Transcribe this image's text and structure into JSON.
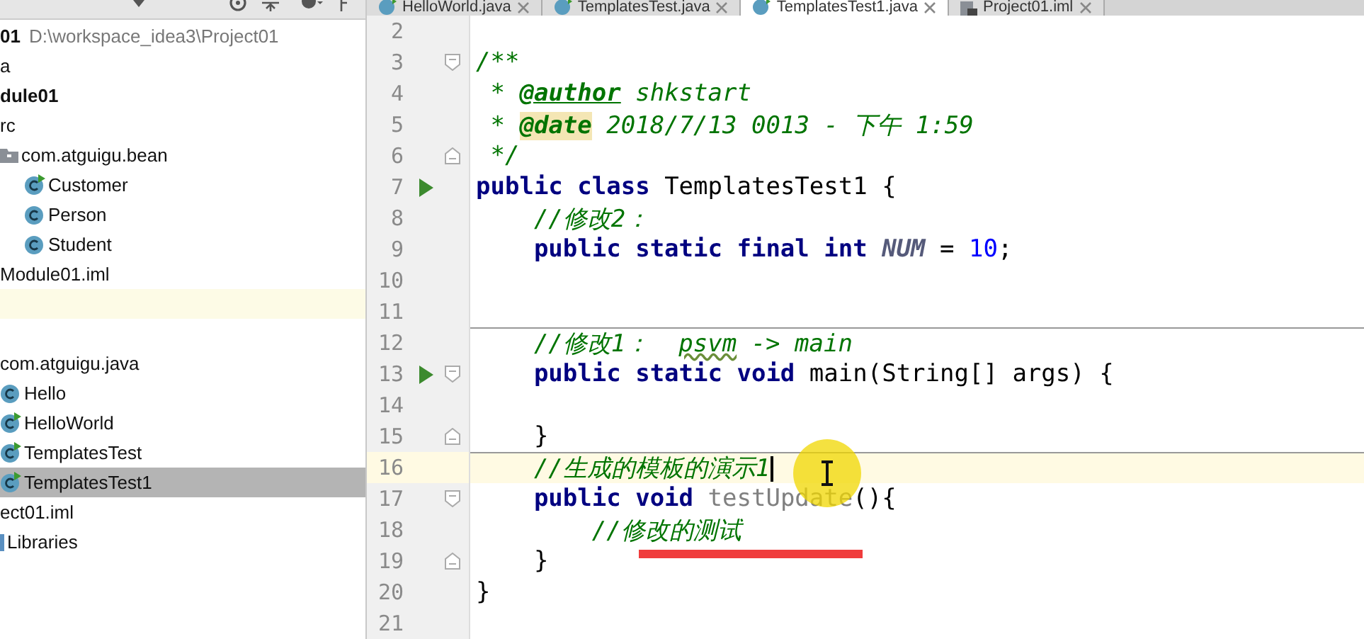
{
  "sidebar": {
    "tree": [
      {
        "label": "01",
        "path": "D:\\workspace_idea3\\Project01",
        "bold": true,
        "selected": false,
        "children": [
          {
            "label": "a",
            "selected": false
          },
          {
            "label": "dule01",
            "bold": true,
            "selected": false,
            "children": [
              {
                "label": "rc",
                "selected": false,
                "children": [
                  {
                    "label": "com.atguigu.bean",
                    "kind": "package",
                    "selected": false,
                    "children": [
                      {
                        "label": "Customer",
                        "kind": "class",
                        "runnable": true,
                        "selected": false
                      },
                      {
                        "label": "Person",
                        "kind": "class",
                        "runnable": false,
                        "selected": false
                      },
                      {
                        "label": "Student",
                        "kind": "class",
                        "runnable": false,
                        "selected": false
                      }
                    ]
                  }
                ]
              },
              {
                "label": "Module01.iml",
                "selected": false
              }
            ]
          },
          {
            "label": "com.atguigu.java",
            "selected": false,
            "children": [
              {
                "label": "Hello",
                "kind": "class",
                "runnable": false,
                "selected": false
              },
              {
                "label": "HelloWorld",
                "kind": "class",
                "runnable": true,
                "selected": false
              },
              {
                "label": "TemplatesTest",
                "kind": "class",
                "runnable": true,
                "selected": false
              },
              {
                "label": "TemplatesTest1",
                "kind": "class",
                "runnable": true,
                "selected": true
              }
            ]
          },
          {
            "label": "ect01.iml",
            "selected": false
          }
        ]
      },
      {
        "label": "Libraries",
        "kind": "library",
        "selected": false
      }
    ]
  },
  "tabs": [
    {
      "label": "HelloWorld.java",
      "kind": "class",
      "selected": false
    },
    {
      "label": "TemplatesTest.java",
      "kind": "class",
      "selected": false
    },
    {
      "label": "TemplatesTest1.java",
      "kind": "class",
      "selected": true
    },
    {
      "label": "Project01.iml",
      "kind": "module",
      "selected": false
    }
  ],
  "editor": {
    "lines": [
      {
        "number": "2"
      },
      {
        "number": "3",
        "fold_start": true,
        "tokens": [
          {
            "kind": "comment",
            "text": "/**"
          }
        ]
      },
      {
        "number": "4",
        "tokens": [
          {
            "kind": "comment",
            "text": " * "
          },
          {
            "kind": "doctag",
            "text": "@author"
          },
          {
            "kind": "comment",
            "text": " shkstart"
          }
        ]
      },
      {
        "number": "5",
        "tokens": [
          {
            "kind": "comment",
            "text": " * "
          },
          {
            "kind": "doctag-hl",
            "text": "@date"
          },
          {
            "kind": "comment",
            "text": " 2018/7/13 0013 - 下午 1:59"
          }
        ]
      },
      {
        "number": "6",
        "fold_end": true,
        "tokens": [
          {
            "kind": "comment",
            "text": " */"
          }
        ]
      },
      {
        "number": "7",
        "run": true,
        "tokens": [
          {
            "kind": "keyword",
            "text": "public class"
          },
          {
            "kind": "plain",
            "text": " TemplatesTest1 {"
          }
        ]
      },
      {
        "number": "8",
        "tokens": [
          {
            "kind": "comment",
            "text": "    //修改2："
          }
        ]
      },
      {
        "number": "9",
        "tokens": [
          {
            "kind": "keyword",
            "text": "    public static final int "
          },
          {
            "kind": "constant",
            "text": "NUM"
          },
          {
            "kind": "plain",
            "text": " = "
          },
          {
            "kind": "number",
            "text": "10"
          },
          {
            "kind": "plain",
            "text": ";"
          }
        ]
      },
      {
        "number": "10"
      },
      {
        "number": "11"
      },
      {
        "number": "12",
        "separator": true,
        "tokens": [
          {
            "kind": "comment",
            "text": "    //修改1：  "
          },
          {
            "kind": "comment-wavy",
            "text": "psvm"
          },
          {
            "kind": "comment",
            "text": " -> main"
          }
        ]
      },
      {
        "number": "13",
        "run": true,
        "fold_start": true,
        "tokens": [
          {
            "kind": "keyword",
            "text": "    public static void"
          },
          {
            "kind": "plain",
            "text": " main(String[] args) {"
          }
        ]
      },
      {
        "number": "14"
      },
      {
        "number": "15",
        "fold_end": true,
        "tokens": [
          {
            "kind": "plain",
            "text": "    }"
          }
        ]
      },
      {
        "number": "16",
        "separator": true,
        "current": true,
        "tokens": [
          {
            "kind": "comment",
            "text": "    //生成的模板的演示1"
          }
        ]
      },
      {
        "number": "17",
        "fold_start": true,
        "tokens": [
          {
            "kind": "keyword",
            "text": "    public void"
          },
          {
            "kind": "unused",
            "text": " testUpdate"
          },
          {
            "kind": "plain",
            "text": "(){"
          }
        ]
      },
      {
        "number": "18",
        "tokens": [
          {
            "kind": "comment",
            "text": "        //修改的测试"
          }
        ]
      },
      {
        "number": "19",
        "fold_end": true,
        "tokens": [
          {
            "kind": "plain",
            "text": "    }"
          }
        ]
      },
      {
        "number": "20",
        "tokens": [
          {
            "kind": "plain",
            "text": "}"
          }
        ]
      },
      {
        "number": "21"
      }
    ]
  }
}
